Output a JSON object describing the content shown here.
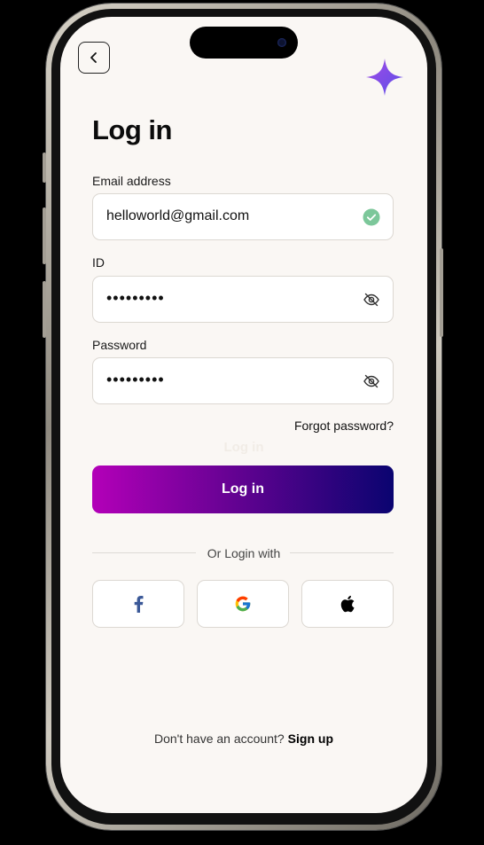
{
  "screen": {
    "title": "Log in",
    "email": {
      "label": "Email address",
      "value": "helloworld@gmail.com",
      "status": "valid"
    },
    "id_field": {
      "label": "ID",
      "value": "•••••••••"
    },
    "password": {
      "label": "Password",
      "value": "•••••••••"
    },
    "forgot_password": "Forgot password?",
    "login_button": "Log in",
    "login_ghost": "Log in",
    "divider_text": "Or Login with",
    "social": [
      {
        "name": "facebook",
        "icon": "facebook-icon"
      },
      {
        "name": "google",
        "icon": "google-icon"
      },
      {
        "name": "apple",
        "icon": "apple-icon"
      }
    ],
    "footer": {
      "prompt": "Don't have an account?",
      "signup": "Sign up"
    }
  },
  "colors": {
    "background": "#faf7f4",
    "button_gradient_start": "#b300b8",
    "button_gradient_end": "#0a0470",
    "accent_sparkle": "#7c4de8",
    "valid_check": "#7cc79a"
  }
}
